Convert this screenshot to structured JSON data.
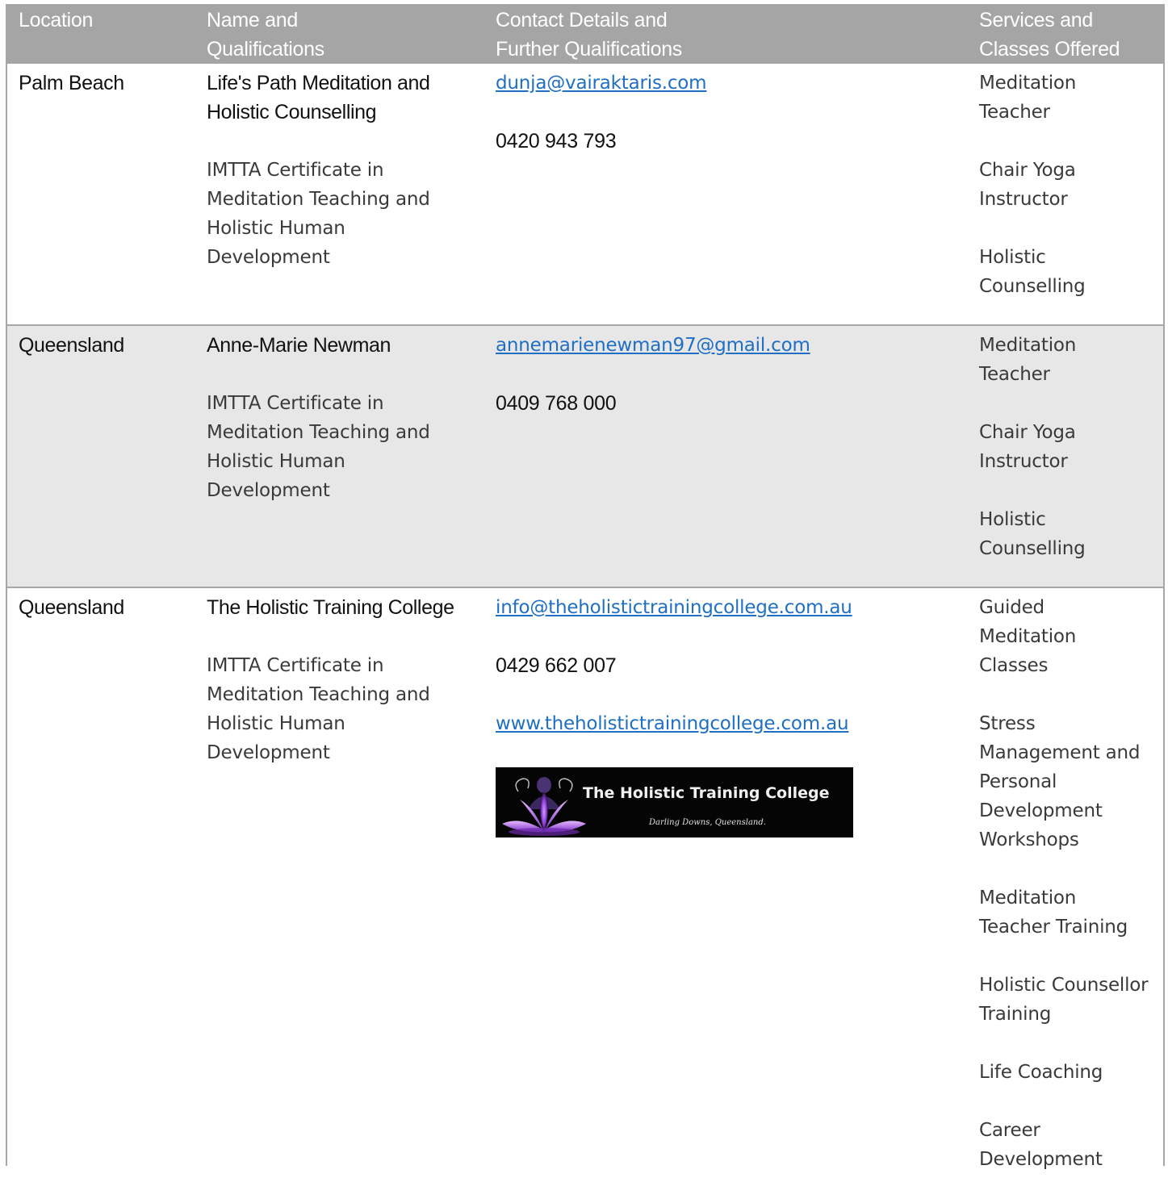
{
  "headers": {
    "location": "Location",
    "name": "Name and Qualifications",
    "contact": "Contact Details and Further Qualifications",
    "services": "Services and Classes Offered"
  },
  "rows": [
    {
      "location": "Palm Beach",
      "name": "Life's Path Meditation and Holistic Counselling",
      "qualification": "IMTTA Certificate in Meditation Teaching and Holistic Human Development",
      "email": "dunja@vairaktaris.com",
      "phone": "0420 943 793",
      "services": [
        "Meditation Teacher",
        "Chair Yoga Instructor",
        "Holistic Counselling"
      ]
    },
    {
      "location": "Queensland",
      "name": "Anne-Marie Newman",
      "qualification": "IMTTA Certificate in Meditation Teaching and Holistic Human Development",
      "email": "annemarienewman97@gmail.com",
      "phone": "0409 768 000",
      "services": [
        "Meditation Teacher",
        "Chair Yoga Instructor",
        "Holistic Counselling"
      ]
    },
    {
      "location": "Queensland",
      "name": "The Holistic Training College",
      "qualification": "IMTTA Certificate in Meditation Teaching and Holistic Human Development",
      "email": "info@theholistictrainingcollege.com.au",
      "phone": "0429 662 007",
      "website": "www.theholistictrainingcollege.com.au",
      "logo": {
        "title": "The Holistic Training College",
        "subtitle": "Darling Downs, Queensland.",
        "icon": "lotus-buddha-icon"
      },
      "services": [
        "Guided Meditation Classes",
        "Stress Management and Personal Development Workshops",
        "Meditation Teacher Training",
        "Holistic Counsellor Training",
        "Life Coaching",
        "Career Development"
      ]
    }
  ],
  "colors": {
    "header_bg": "#a5a5a5",
    "alt_row_bg": "#e7e7e7",
    "link": "#1f6fc5",
    "border": "#a6a6a6"
  }
}
